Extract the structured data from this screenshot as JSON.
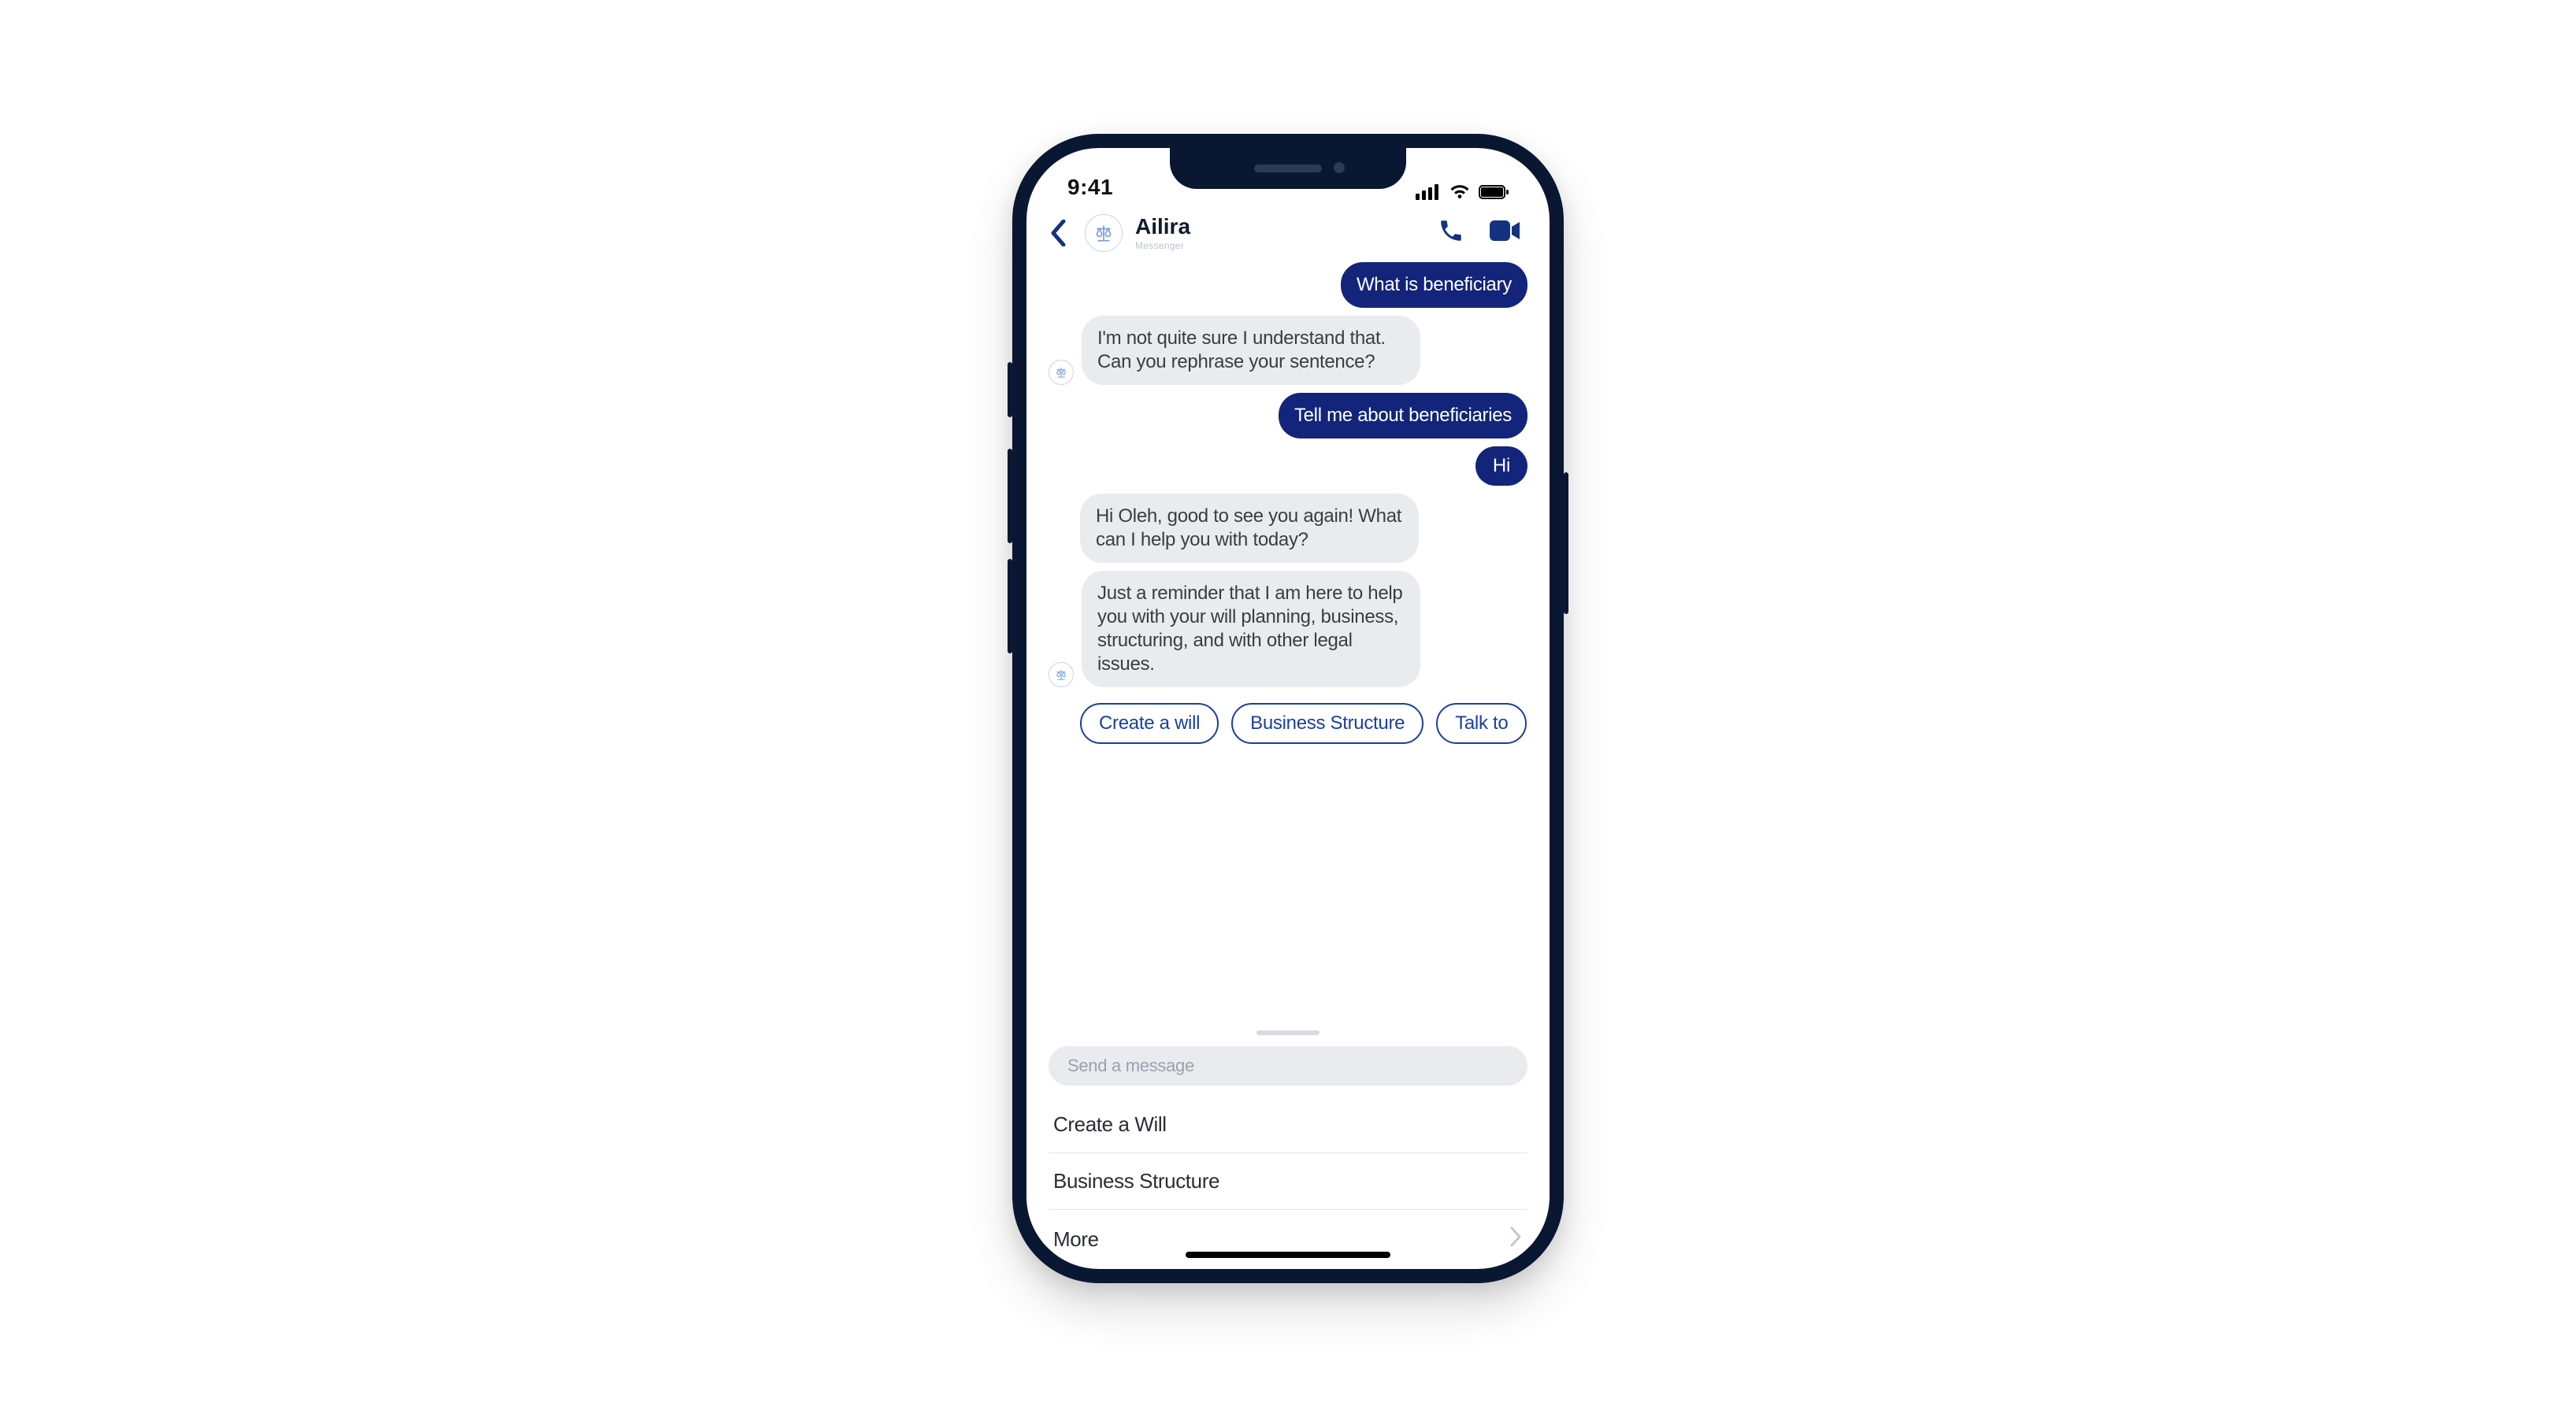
{
  "status": {
    "time": "9:41"
  },
  "header": {
    "title": "Ailira",
    "subtitle": "Messenger"
  },
  "messages": {
    "m0": "What is beneficiary",
    "m1": "I'm not quite sure I understand that. Can you rephrase your sentence?",
    "m2": "Tell me about beneficiaries",
    "m3": "Hi",
    "m4": "Hi Oleh, good to see you again! What can I help you with today?",
    "m5": "Just a reminder that I am here to help you with your will planning, business, structuring, and with other legal issues."
  },
  "chips": {
    "c0": "Create a will",
    "c1": "Business Structure",
    "c2": "Talk to"
  },
  "composer": {
    "placeholder": "Send a message"
  },
  "menu": {
    "i0": "Create a Will",
    "i1": "Business Structure",
    "i2": "More"
  }
}
